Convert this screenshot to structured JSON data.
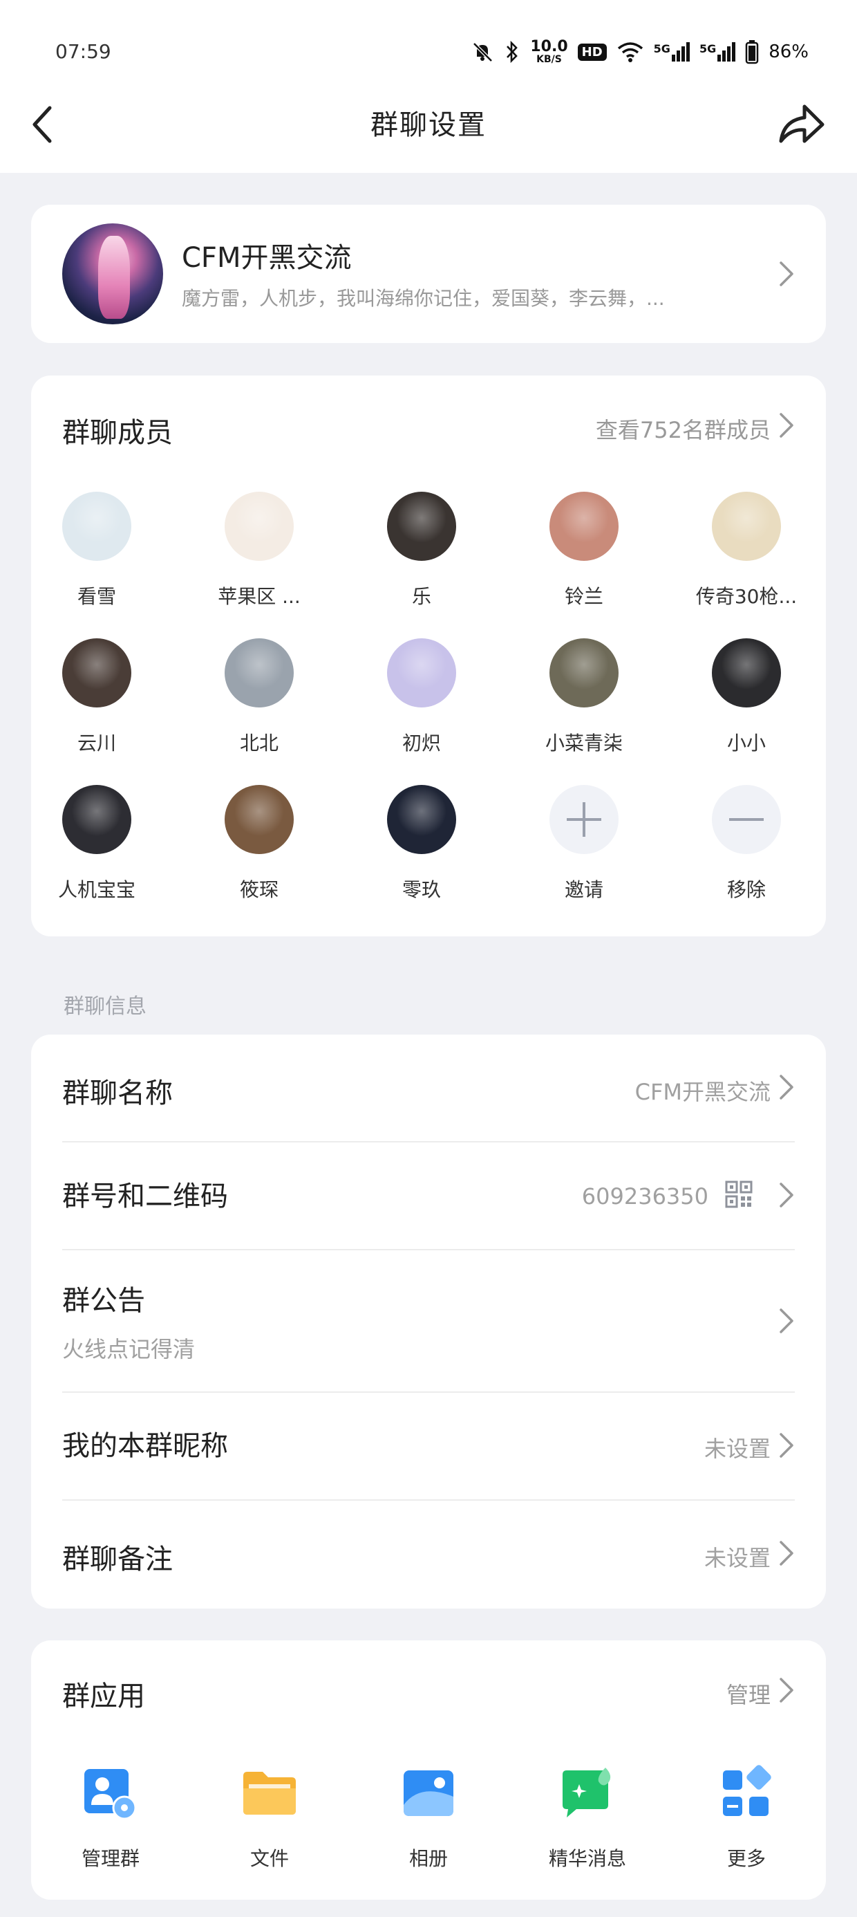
{
  "status_bar": {
    "time": "07:59",
    "net_speed": "10.0",
    "net_speed_unit": "KB/S",
    "hd": "HD",
    "signal1": "5G",
    "signal2": "5G",
    "battery": "86%"
  },
  "nav": {
    "title": "群聊设置"
  },
  "group": {
    "name": "CFM开黑交流",
    "members_preview": "魔方雷，人机步，我叫海绵你记住，爱国葵，李云舞，..."
  },
  "members": {
    "title": "群聊成员",
    "view_all": "查看752名群成员",
    "list": [
      {
        "name": "看雪",
        "color": "#dfe9ef"
      },
      {
        "name": "苹果区 ...",
        "color": "#f4ece4"
      },
      {
        "name": "乐",
        "color": "#3a3431"
      },
      {
        "name": "铃兰",
        "color": "#c98b7a"
      },
      {
        "name": "传奇30枪...",
        "color": "#e9dcc0"
      },
      {
        "name": "云川",
        "color": "#4a3d37"
      },
      {
        "name": "北北",
        "color": "#9aa3ad"
      },
      {
        "name": "初炽",
        "color": "#c8c2ea"
      },
      {
        "name": "小菜青柒",
        "color": "#6e6a58"
      },
      {
        "name": "小小",
        "color": "#2b2b2e"
      },
      {
        "name": "人机宝宝",
        "color": "#2d2d33"
      },
      {
        "name": "筱琛",
        "color": "#7a5a40"
      },
      {
        "name": "零玖",
        "color": "#1f2536"
      }
    ],
    "invite_label": "邀请",
    "remove_label": "移除"
  },
  "info_section": {
    "label": "群聊信息",
    "name_label": "群聊名称",
    "name_value": "CFM开黑交流",
    "number_label": "群号和二维码",
    "number_value": "609236350",
    "notice_label": "群公告",
    "notice_sub": "火线点记得清",
    "nickname_label": "我的本群昵称",
    "nickname_value": "未设置",
    "remark_label": "群聊备注",
    "remark_value": "未设置"
  },
  "apps": {
    "title": "群应用",
    "manage": "管理",
    "items": [
      {
        "label": "管理群",
        "icon": "manage-group-icon",
        "color": "#2f8df4"
      },
      {
        "label": "文件",
        "icon": "folder-icon",
        "color": "#f6b336"
      },
      {
        "label": "相册",
        "icon": "album-icon",
        "color": "#2f8df4"
      },
      {
        "label": "精华消息",
        "icon": "featured-message-icon",
        "color": "#1fc26b"
      },
      {
        "label": "更多",
        "icon": "more-apps-icon",
        "color": "#2f8df4"
      }
    ]
  }
}
